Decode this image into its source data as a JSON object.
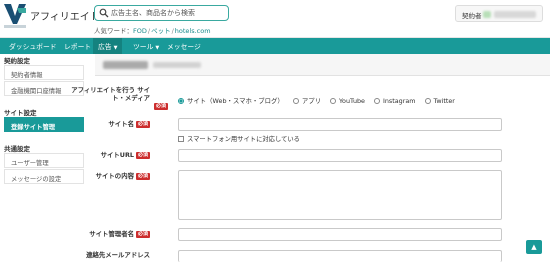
{
  "header": {
    "brand": "アフィリエイト",
    "search_placeholder": "広告主名、商品名から検索",
    "popular_label": "人気ワード：",
    "popular_words": [
      "FOD",
      "ペット",
      "hotels.com"
    ],
    "account_label": "契約者"
  },
  "nav": {
    "items": [
      {
        "label": "ダッシュボード"
      },
      {
        "label": "レポート"
      },
      {
        "label": "広告"
      },
      {
        "label": "ツール"
      },
      {
        "label": "メッセージ"
      }
    ]
  },
  "sidebar": {
    "sections": [
      {
        "title": "契約設定",
        "items": [
          "契約者情報",
          "金融機関口座情報"
        ]
      },
      {
        "title": "サイト設定",
        "items": [
          "登録サイト管理"
        ]
      },
      {
        "title": "共通設定",
        "items": [
          "ユーザー管理",
          "メッセージの設定"
        ]
      }
    ]
  },
  "form": {
    "media_label": "アフィリエイトを行う サイト・メディア",
    "required_badge": "必須",
    "media_options": [
      "サイト（Web・スマホ・ブログ）",
      "アプリ",
      "YouTube",
      "Instagram",
      "Twitter"
    ],
    "media_selected": "サイト（Web・スマホ・ブログ）",
    "site_name_label": "サイト名",
    "smartphone_checkbox": "スマートフォン用サイトに対応している",
    "site_url_label": "サイトURL",
    "site_content_label": "サイトの内容",
    "site_admin_label": "サイト管理者名",
    "contact_email_label": "連絡先メールアドレス"
  },
  "colors": {
    "accent": "#199a99",
    "required": "#cc2d2d"
  }
}
